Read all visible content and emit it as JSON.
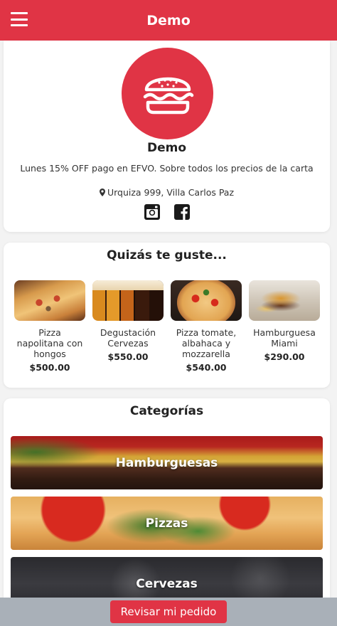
{
  "header": {
    "title": "Demo",
    "menu_icon": "hamburger-menu-icon",
    "color": "#e03445"
  },
  "store": {
    "logo_icon": "burger-icon",
    "name": "Demo",
    "promo": "Lunes 15% OFF pago en EFVO. Sobre todos los precios de la carta",
    "address": "Urquiza 999, Villa Carlos Paz",
    "address_icon": "map-pin-icon",
    "socials": [
      "instagram-icon",
      "facebook-icon"
    ]
  },
  "suggestions": {
    "title": "Quizás te guste...",
    "items": [
      {
        "name": "Pizza napolitana con hongos",
        "price": "$500.00"
      },
      {
        "name": "Degustación Cervezas",
        "price": "$550.00"
      },
      {
        "name": "Pizza tomate, albahaca y mozzarella",
        "price": "$540.00"
      },
      {
        "name": "Hamburguesa Miami",
        "price": "$290.00"
      }
    ]
  },
  "categories": {
    "title": "Categorías",
    "items": [
      {
        "name": "Hamburguesas"
      },
      {
        "name": "Pizzas"
      },
      {
        "name": "Cervezas"
      }
    ]
  },
  "footer": {
    "order_button": "Revisar mi pedido"
  }
}
